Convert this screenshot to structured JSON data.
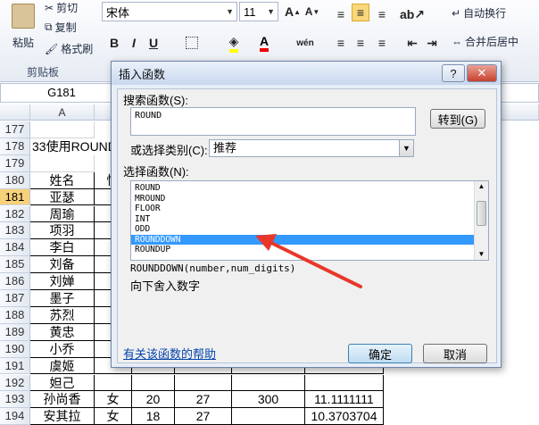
{
  "ribbon": {
    "paste_label": "粘贴",
    "cut_label": "剪切",
    "copy_label": "复制",
    "format_painter_label": "格式刷",
    "clipboard_group": "剪贴板",
    "font_name": "宋体",
    "font_size": "11",
    "wrap_text_label": "自动换行",
    "merge_center_label": "合并后居中"
  },
  "name_box": "G181",
  "columns": [
    "A"
  ],
  "rows": [
    {
      "num": "177",
      "cells": []
    },
    {
      "num": "178",
      "cells": [
        "33使用ROUND"
      ]
    },
    {
      "num": "179",
      "cells": []
    },
    {
      "num": "180",
      "cells": [
        "姓名",
        "性"
      ]
    },
    {
      "num": "181",
      "cells": [
        "亚瑟"
      ]
    },
    {
      "num": "182",
      "cells": [
        "周瑜"
      ]
    },
    {
      "num": "183",
      "cells": [
        "项羽"
      ]
    },
    {
      "num": "184",
      "cells": [
        "李白"
      ]
    },
    {
      "num": "185",
      "cells": [
        "刘备"
      ]
    },
    {
      "num": "186",
      "cells": [
        "刘婵"
      ]
    },
    {
      "num": "187",
      "cells": [
        "墨子"
      ]
    },
    {
      "num": "188",
      "cells": [
        "苏烈"
      ]
    },
    {
      "num": "189",
      "cells": [
        "黄忠"
      ]
    },
    {
      "num": "190",
      "cells": [
        "小乔"
      ]
    },
    {
      "num": "191",
      "cells": [
        "虞姬"
      ]
    },
    {
      "num": "192",
      "cells": [
        "妲己"
      ]
    },
    {
      "num": "193",
      "cells": [
        "孙尚香",
        "女",
        "20",
        "27",
        "300",
        "11.1111111"
      ]
    },
    {
      "num": "194",
      "cells": [
        "安其拉",
        "女",
        "18",
        "27",
        "",
        "10.3703704"
      ]
    }
  ],
  "dialog": {
    "title": "插入函数",
    "help_btn": "?",
    "close_btn": "✕",
    "search_label": "搜索函数(S):",
    "search_value": "ROUND",
    "go_button": "转到(G)",
    "category_label": "或选择类别(C):",
    "category_value": "推荐",
    "select_label": "选择函数(N):",
    "functions": [
      "ROUND",
      "MROUND",
      "FLOOR",
      "INT",
      "ODD",
      "ROUNDDOWN",
      "ROUNDUP"
    ],
    "selected_index": 5,
    "syntax": "ROUNDDOWN(number,num_digits)",
    "description": "向下舍入数字",
    "help_link": "有关该函数的帮助",
    "ok_button": "确定",
    "cancel_button": "取消"
  },
  "colors": {
    "selection": "#3399ff",
    "arrow": "#e8372a",
    "row_header_selected": "#f7d27a"
  }
}
